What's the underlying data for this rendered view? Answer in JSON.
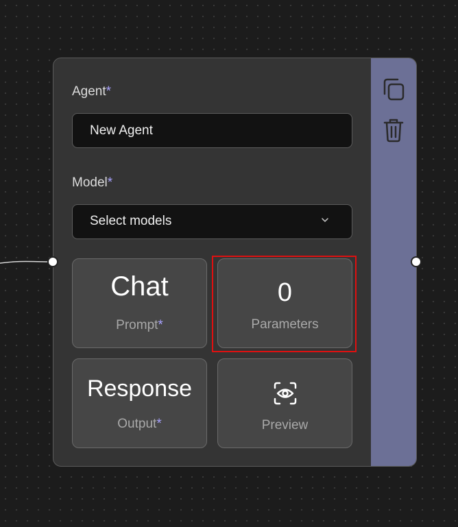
{
  "node": {
    "agent_label": "Agent",
    "agent_required": "*",
    "agent_value": "New Agent",
    "model_label": "Model",
    "model_required": "*",
    "model_value": "Select models",
    "tiles": {
      "prompt": {
        "big": "Chat",
        "label": "Prompt",
        "required": "*"
      },
      "parameters": {
        "big": "0",
        "label": "Parameters"
      },
      "output": {
        "big": "Response",
        "label": "Output",
        "required": "*"
      },
      "preview": {
        "label": "Preview",
        "icon": "eye-scan-icon"
      }
    }
  },
  "side_rail": {
    "icons": [
      "copy-icon",
      "trash-icon"
    ]
  },
  "colors": {
    "canvas": "#1c1c1c",
    "node": "#343434",
    "rail": "#6c7096",
    "required": "#a8a2ff",
    "highlight": "#e01010"
  }
}
